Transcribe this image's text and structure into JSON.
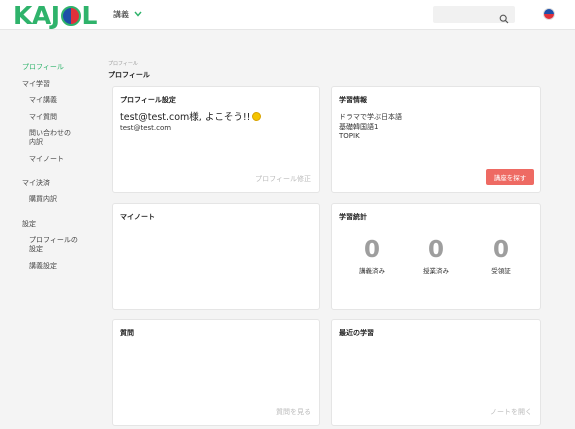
{
  "header": {
    "logo_pre": "KAJ",
    "logo_post": "L",
    "courses_menu": "講義",
    "search_placeholder": ""
  },
  "sidebar": {
    "profile": "プロフィール",
    "my_learning": "マイ学習",
    "my_courses": "マイ講義",
    "my_questions": "マイ質問",
    "my_inquiries_1": "問い合わせの",
    "my_inquiries_2": "内訳",
    "my_notes": "マイノート",
    "my_payments": "マイ決済",
    "purchase_history": "購買内訳",
    "settings": "設定",
    "profile_settings_1": "プロフィールの",
    "profile_settings_2": "設定",
    "course_settings": "講義設定"
  },
  "main": {
    "breadcrumb": "プロフィール",
    "title": "プロフィール"
  },
  "cards": {
    "profile": {
      "title": "プロフィール設定",
      "greeting": "test@test.com様, よこそう!!",
      "email": "test@test.com",
      "link": "プロフィール修正"
    },
    "learning_info": {
      "title": "学習情報",
      "lines": [
        "ドラマで学ぶ日本語",
        "基礎韓国語1",
        "TOPIK"
      ],
      "button": "講座を探す"
    },
    "my_notes": {
      "title": "マイノート"
    },
    "stats": {
      "title": "学習統計",
      "items": [
        {
          "value": "0",
          "label": "講義済み"
        },
        {
          "value": "0",
          "label": "授業済み"
        },
        {
          "value": "0",
          "label": "受領証"
        }
      ]
    },
    "questions": {
      "title": "質問",
      "link": "質問を見る"
    },
    "recent": {
      "title": "最近の学習",
      "link": "ノートを開く"
    }
  },
  "colors": {
    "accent": "#2fb36b",
    "button": "#ee6a63"
  }
}
